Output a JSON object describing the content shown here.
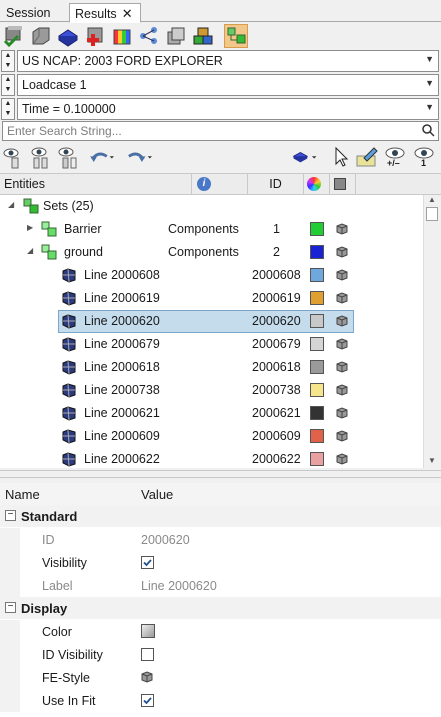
{
  "tabs": {
    "session": "Session",
    "results": "Results",
    "close_glyph": "✕"
  },
  "dropdowns": {
    "model": "US NCAP: 2003 FORD EXPLORER",
    "loadcase": "Loadcase 1",
    "time": "Time = 0.100000"
  },
  "search": {
    "placeholder": "Enter Search String..."
  },
  "toolbar2": {
    "minus_label": "+/–",
    "one_label": "1"
  },
  "tree_header": {
    "entities": "Entities",
    "id": "ID"
  },
  "tree": {
    "sets": {
      "label": "Sets (25)"
    },
    "rows": [
      {
        "name": "Barrier",
        "type": "Components",
        "id": "1",
        "color": "#22cc33"
      },
      {
        "name": "ground",
        "type": "Components",
        "id": "2",
        "color": "#1a23d4"
      },
      {
        "name": "Line 2000608",
        "id": "2000608",
        "color": "#6fa8dc"
      },
      {
        "name": "Line 2000619",
        "id": "2000619",
        "color": "#e0a030"
      },
      {
        "name": "Line 2000620",
        "id": "2000620",
        "color": "#c8c8c8"
      },
      {
        "name": "Line 2000679",
        "id": "2000679",
        "color": "#d5d5d5"
      },
      {
        "name": "Line 2000618",
        "id": "2000618",
        "color": "#9a9a9a"
      },
      {
        "name": "Line 2000738",
        "id": "2000738",
        "color": "#f6e58a"
      },
      {
        "name": "Line 2000621",
        "id": "2000621",
        "color": "#333333"
      },
      {
        "name": "Line 2000609",
        "id": "2000609",
        "color": "#e0624a"
      },
      {
        "name": "Line 2000622",
        "id": "2000622",
        "color": "#e8a0a0"
      }
    ],
    "selected_index": 4
  },
  "props": {
    "header_name": "Name",
    "header_value": "Value",
    "section_standard": "Standard",
    "section_display": "Display",
    "collapse_glyph": "−",
    "id_label": "ID",
    "id_value": "2000620",
    "visibility_label": "Visibility",
    "visibility_checked": true,
    "label_label": "Label",
    "label_value": "Line 2000620",
    "color_label": "Color",
    "id_visibility_label": "ID Visibility",
    "id_visibility_checked": false,
    "fe_style_label": "FE-Style",
    "use_in_fit_label": "Use In Fit",
    "use_in_fit_checked": true
  },
  "icons": {
    "toolbar": [
      "part-check-icon",
      "part-icon",
      "component-icon",
      "add-part-icon",
      "contour-icon",
      "hierarchy-icon",
      "assembly-icon",
      "components-icon",
      "add-set-icon"
    ],
    "toolbar2": [
      "show-icon",
      "show-columns-icon",
      "filter-columns-icon",
      "undo-icon",
      "redo-icon",
      "display-component-icon",
      "cursor-icon",
      "pencil-icon",
      "isolate-icon",
      "show-one-icon"
    ]
  }
}
